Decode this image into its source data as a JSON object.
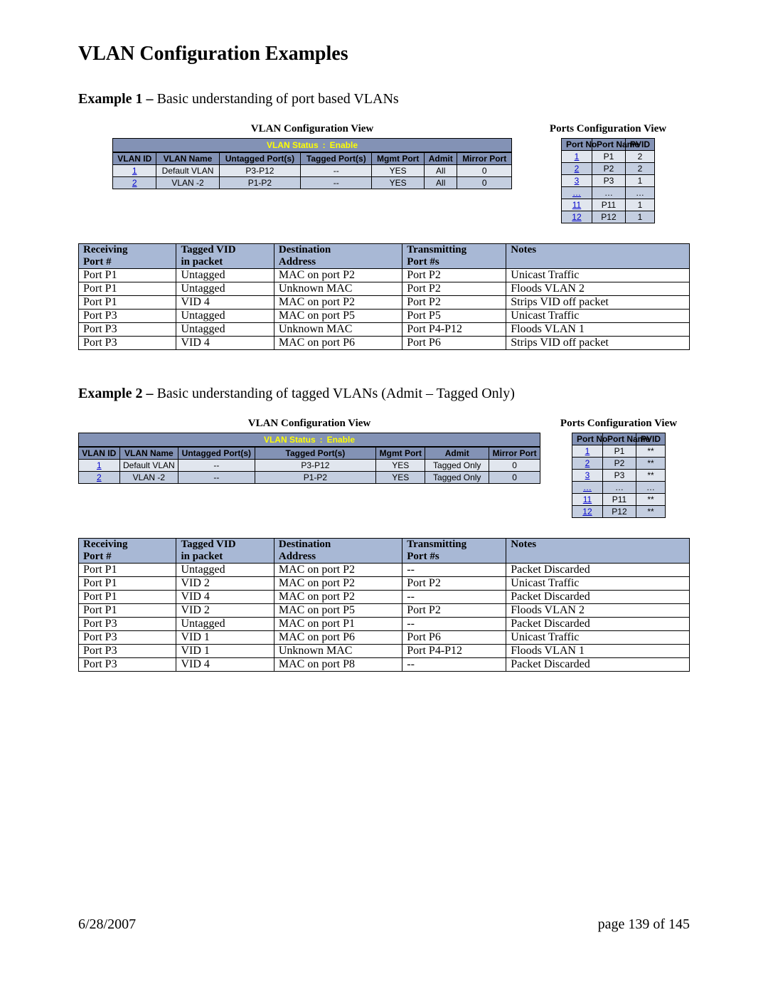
{
  "page_title": "VLAN Configuration Examples",
  "example1": {
    "label_strong": "Example 1 –",
    "label_rest": " Basic understanding of port based VLANs",
    "vlan_view_title": "VLAN Configuration View",
    "ports_view_title": "Ports Configuration View",
    "vlan_status_label": "VLAN Status",
    "vlan_status_sep": ":",
    "vlan_status_value": "Enable",
    "cfg_headers": {
      "vlan_id": "VLAN ID",
      "vlan_name": "VLAN Name",
      "untagged": "Untagged Port(s)",
      "tagged": "Tagged Port(s)",
      "mgmt": "Mgmt Port",
      "admit": "Admit",
      "mirror": "Mirror Port"
    },
    "cfg_rows": [
      {
        "id": "1",
        "name": "Default VLAN",
        "untagged": "P3-P12",
        "tagged": "--",
        "mgmt": "YES",
        "admit": "All",
        "mirror": "0"
      },
      {
        "id": "2",
        "name": "VLAN -2",
        "untagged": "P1-P2",
        "tagged": "--",
        "mgmt": "YES",
        "admit": "All",
        "mirror": "0"
      }
    ],
    "ports_headers": {
      "no": "Port No",
      "name": "Port Name",
      "pvid": "PVID"
    },
    "ports_rows": [
      {
        "no": "1",
        "name": "P1",
        "pvid": "2"
      },
      {
        "no": "2",
        "name": "P2",
        "pvid": "2"
      },
      {
        "no": "3",
        "name": "P3",
        "pvid": "1"
      },
      {
        "no": "…",
        "name": "…",
        "pvid": "…"
      },
      {
        "no": "11",
        "name": "P11",
        "pvid": "1"
      },
      {
        "no": "12",
        "name": "P12",
        "pvid": "1"
      }
    ],
    "traffic_headers": {
      "recv": "Receiving Port #",
      "vid": "Tagged VID in packet",
      "dest": "Destination Address",
      "tx": "Transmitting Port #s",
      "notes": "Notes"
    },
    "traffic_rows": [
      {
        "recv": "Port P1",
        "vid": "Untagged",
        "dest": "MAC on port P2",
        "tx": "Port P2",
        "notes": "Unicast Traffic"
      },
      {
        "recv": "Port P1",
        "vid": "Untagged",
        "dest": "Unknown MAC",
        "tx": "Port P2",
        "notes": "Floods VLAN 2"
      },
      {
        "recv": "Port P1",
        "vid": "VID 4",
        "dest": "MAC on port P2",
        "tx": "Port P2",
        "notes": "Strips VID off packet"
      },
      {
        "recv": "Port P3",
        "vid": "Untagged",
        "dest": "MAC on port P5",
        "tx": "Port P5",
        "notes": "Unicast Traffic"
      },
      {
        "recv": "Port P3",
        "vid": "Untagged",
        "dest": "Unknown MAC",
        "tx": "Port P4-P12",
        "notes": "Floods VLAN 1"
      },
      {
        "recv": "Port P3",
        "vid": "VID 4",
        "dest": "MAC on port P6",
        "tx": "Port P6",
        "notes": "Strips VID off packet"
      }
    ]
  },
  "example2": {
    "label_strong": "Example 2 –",
    "label_rest": " Basic understanding of tagged VLANs (Admit – Tagged Only)",
    "vlan_view_title": "VLAN Configuration View",
    "ports_view_title": "Ports Configuration View",
    "vlan_status_label": "VLAN Status",
    "vlan_status_sep": ":",
    "vlan_status_value": "Enable",
    "cfg_headers": {
      "vlan_id": "VLAN ID",
      "vlan_name": "VLAN Name",
      "untagged": "Untagged Port(s)",
      "tagged": "Tagged Port(s)",
      "mgmt": "Mgmt Port",
      "admit": "Admit",
      "mirror": "Mirror Port"
    },
    "cfg_rows": [
      {
        "id": "1",
        "name": "Default VLAN",
        "untagged": "--",
        "tagged": "P3-P12",
        "mgmt": "YES",
        "admit": "Tagged Only",
        "mirror": "0"
      },
      {
        "id": "2",
        "name": "VLAN -2",
        "untagged": "--",
        "tagged": "P1-P2",
        "mgmt": "YES",
        "admit": "Tagged Only",
        "mirror": "0"
      }
    ],
    "ports_headers": {
      "no": "Port No",
      "name": "Port Name",
      "pvid": "PVID"
    },
    "ports_rows": [
      {
        "no": "1",
        "name": "P1",
        "pvid": "**"
      },
      {
        "no": "2",
        "name": "P2",
        "pvid": "**"
      },
      {
        "no": "3",
        "name": "P3",
        "pvid": "**"
      },
      {
        "no": "…",
        "name": "…",
        "pvid": "…"
      },
      {
        "no": "11",
        "name": "P11",
        "pvid": "**"
      },
      {
        "no": "12",
        "name": "P12",
        "pvid": "**"
      }
    ],
    "traffic_headers": {
      "recv": "Receiving Port #",
      "vid": "Tagged VID in packet",
      "dest": "Destination Address",
      "tx": "Transmitting Port #s",
      "notes": "Notes"
    },
    "traffic_rows": [
      {
        "recv": "Port P1",
        "vid": "Untagged",
        "dest": "MAC on port P2",
        "tx": "--",
        "notes": "Packet Discarded"
      },
      {
        "recv": "Port P1",
        "vid": "VID 2",
        "dest": "MAC on port P2",
        "tx": "Port P2",
        "notes": "Unicast Traffic"
      },
      {
        "recv": "Port P1",
        "vid": "VID 4",
        "dest": "MAC on port P2",
        "tx": "--",
        "notes": "Packet Discarded"
      },
      {
        "recv": "Port P1",
        "vid": "VID 2",
        "dest": "MAC on port P5",
        "tx": "Port P2",
        "notes": "Floods VLAN 2"
      },
      {
        "recv": "Port P3",
        "vid": "Untagged",
        "dest": "MAC on port P1",
        "tx": "--",
        "notes": "Packet Discarded"
      },
      {
        "recv": "Port P3",
        "vid": "VID 1",
        "dest": "MAC on port P6",
        "tx": "Port P6",
        "notes": "Unicast Traffic"
      },
      {
        "recv": "Port P3",
        "vid": "VID 1",
        "dest": "Unknown MAC",
        "tx": "Port P4-P12",
        "notes": "Floods VLAN 1"
      },
      {
        "recv": "Port P3",
        "vid": "VID 4",
        "dest": "MAC on port P8",
        "tx": "--",
        "notes": "Packet Discarded"
      }
    ]
  },
  "footer": {
    "date": "6/28/2007",
    "page": "page 139 of 145"
  }
}
